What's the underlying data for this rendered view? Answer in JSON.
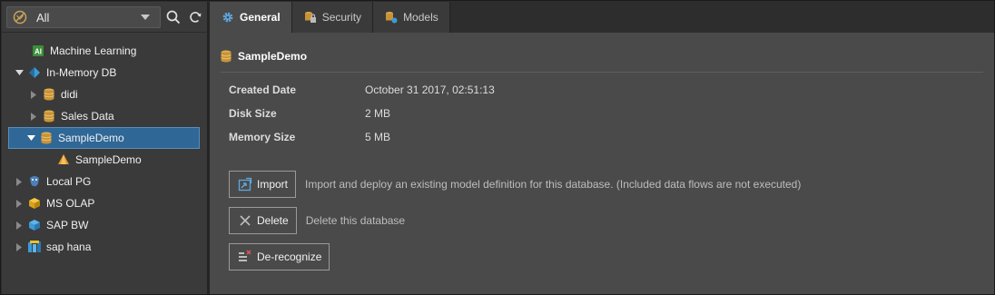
{
  "filter": {
    "selected": "All",
    "icon": "filter-off-icon"
  },
  "toolbar": {
    "search_icon": "search-icon",
    "refresh_icon": "refresh-icon"
  },
  "tree": {
    "items": [
      {
        "label": "Machine Learning",
        "icon": "ai-icon",
        "expanded": null
      },
      {
        "label": "In-Memory DB",
        "icon": "in-memory-icon",
        "expanded": true
      },
      {
        "label": "didi",
        "icon": "database-icon",
        "expanded": false
      },
      {
        "label": "Sales Data",
        "icon": "database-icon",
        "expanded": false
      },
      {
        "label": "SampleDemo",
        "icon": "database-icon",
        "expanded": true,
        "selected": true
      },
      {
        "label": "SampleDemo",
        "icon": "model-icon",
        "expanded": null
      },
      {
        "label": "Local PG",
        "icon": "postgres-icon",
        "expanded": false
      },
      {
        "label": "MS OLAP",
        "icon": "olap-cube-icon",
        "expanded": false
      },
      {
        "label": "SAP BW",
        "icon": "sap-bw-icon",
        "expanded": false
      },
      {
        "label": "sap hana",
        "icon": "sap-hana-icon",
        "expanded": false
      }
    ]
  },
  "tabs": [
    {
      "label": "General",
      "icon": "gear-icon",
      "active": true
    },
    {
      "label": "Security",
      "icon": "security-icon",
      "active": false
    },
    {
      "label": "Models",
      "icon": "models-icon",
      "active": false
    }
  ],
  "content": {
    "title": "SampleDemo",
    "properties": [
      {
        "name": "Created Date",
        "value": "October 31 2017, 02:51:13"
      },
      {
        "name": "Disk Size",
        "value": "2 MB"
      },
      {
        "name": "Memory Size",
        "value": "5 MB"
      }
    ],
    "actions": {
      "import_label": "Import",
      "import_desc": "Import and deploy an existing model definition for this database. (Included data flows are not executed)",
      "delete_label": "Delete",
      "delete_desc": "Delete this database",
      "derecognize_label": "De-recognize"
    }
  },
  "colors": {
    "selection": "#2f6796",
    "database": "#d9a441",
    "accent_blue": "#3c9bd8"
  }
}
